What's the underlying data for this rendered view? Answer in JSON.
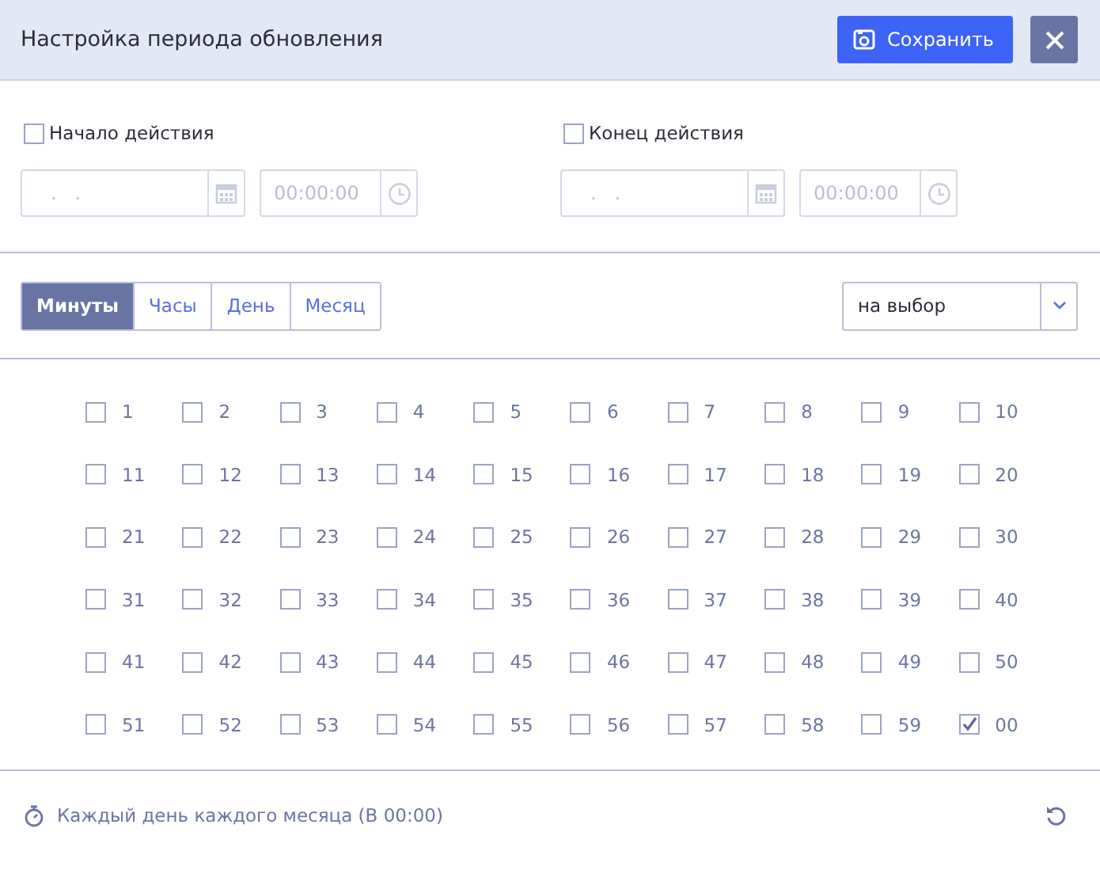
{
  "window": {
    "title": "Настройка периода обновления"
  },
  "buttons": {
    "save": "Сохранить"
  },
  "start": {
    "label": "Начало действия",
    "checked": false,
    "date_placeholder": ".   .",
    "time_placeholder": "00:00:00"
  },
  "end": {
    "label": "Конец действия",
    "checked": false,
    "date_placeholder": ".   .",
    "time_placeholder": "00:00:00"
  },
  "tabs": [
    {
      "label": "Минуты",
      "selected": true
    },
    {
      "label": "Часы",
      "selected": false
    },
    {
      "label": "День",
      "selected": false
    },
    {
      "label": "Месяц",
      "selected": false
    }
  ],
  "mode_select": {
    "value": "на выбор"
  },
  "minutes": [
    {
      "label": "1",
      "checked": false
    },
    {
      "label": "2",
      "checked": false
    },
    {
      "label": "3",
      "checked": false
    },
    {
      "label": "4",
      "checked": false
    },
    {
      "label": "5",
      "checked": false
    },
    {
      "label": "6",
      "checked": false
    },
    {
      "label": "7",
      "checked": false
    },
    {
      "label": "8",
      "checked": false
    },
    {
      "label": "9",
      "checked": false
    },
    {
      "label": "10",
      "checked": false
    },
    {
      "label": "11",
      "checked": false
    },
    {
      "label": "12",
      "checked": false
    },
    {
      "label": "13",
      "checked": false
    },
    {
      "label": "14",
      "checked": false
    },
    {
      "label": "15",
      "checked": false
    },
    {
      "label": "16",
      "checked": false
    },
    {
      "label": "17",
      "checked": false
    },
    {
      "label": "18",
      "checked": false
    },
    {
      "label": "19",
      "checked": false
    },
    {
      "label": "20",
      "checked": false
    },
    {
      "label": "21",
      "checked": false
    },
    {
      "label": "22",
      "checked": false
    },
    {
      "label": "23",
      "checked": false
    },
    {
      "label": "24",
      "checked": false
    },
    {
      "label": "25",
      "checked": false
    },
    {
      "label": "26",
      "checked": false
    },
    {
      "label": "27",
      "checked": false
    },
    {
      "label": "28",
      "checked": false
    },
    {
      "label": "29",
      "checked": false
    },
    {
      "label": "30",
      "checked": false
    },
    {
      "label": "31",
      "checked": false
    },
    {
      "label": "32",
      "checked": false
    },
    {
      "label": "33",
      "checked": false
    },
    {
      "label": "34",
      "checked": false
    },
    {
      "label": "35",
      "checked": false
    },
    {
      "label": "36",
      "checked": false
    },
    {
      "label": "37",
      "checked": false
    },
    {
      "label": "38",
      "checked": false
    },
    {
      "label": "39",
      "checked": false
    },
    {
      "label": "40",
      "checked": false
    },
    {
      "label": "41",
      "checked": false
    },
    {
      "label": "42",
      "checked": false
    },
    {
      "label": "43",
      "checked": false
    },
    {
      "label": "44",
      "checked": false
    },
    {
      "label": "45",
      "checked": false
    },
    {
      "label": "46",
      "checked": false
    },
    {
      "label": "47",
      "checked": false
    },
    {
      "label": "48",
      "checked": false
    },
    {
      "label": "49",
      "checked": false
    },
    {
      "label": "50",
      "checked": false
    },
    {
      "label": "51",
      "checked": false
    },
    {
      "label": "52",
      "checked": false
    },
    {
      "label": "53",
      "checked": false
    },
    {
      "label": "54",
      "checked": false
    },
    {
      "label": "55",
      "checked": false
    },
    {
      "label": "56",
      "checked": false
    },
    {
      "label": "57",
      "checked": false
    },
    {
      "label": "58",
      "checked": false
    },
    {
      "label": "59",
      "checked": false
    },
    {
      "label": "00",
      "checked": true
    }
  ],
  "summary": "Каждый день каждого месяца (В 00:00)"
}
